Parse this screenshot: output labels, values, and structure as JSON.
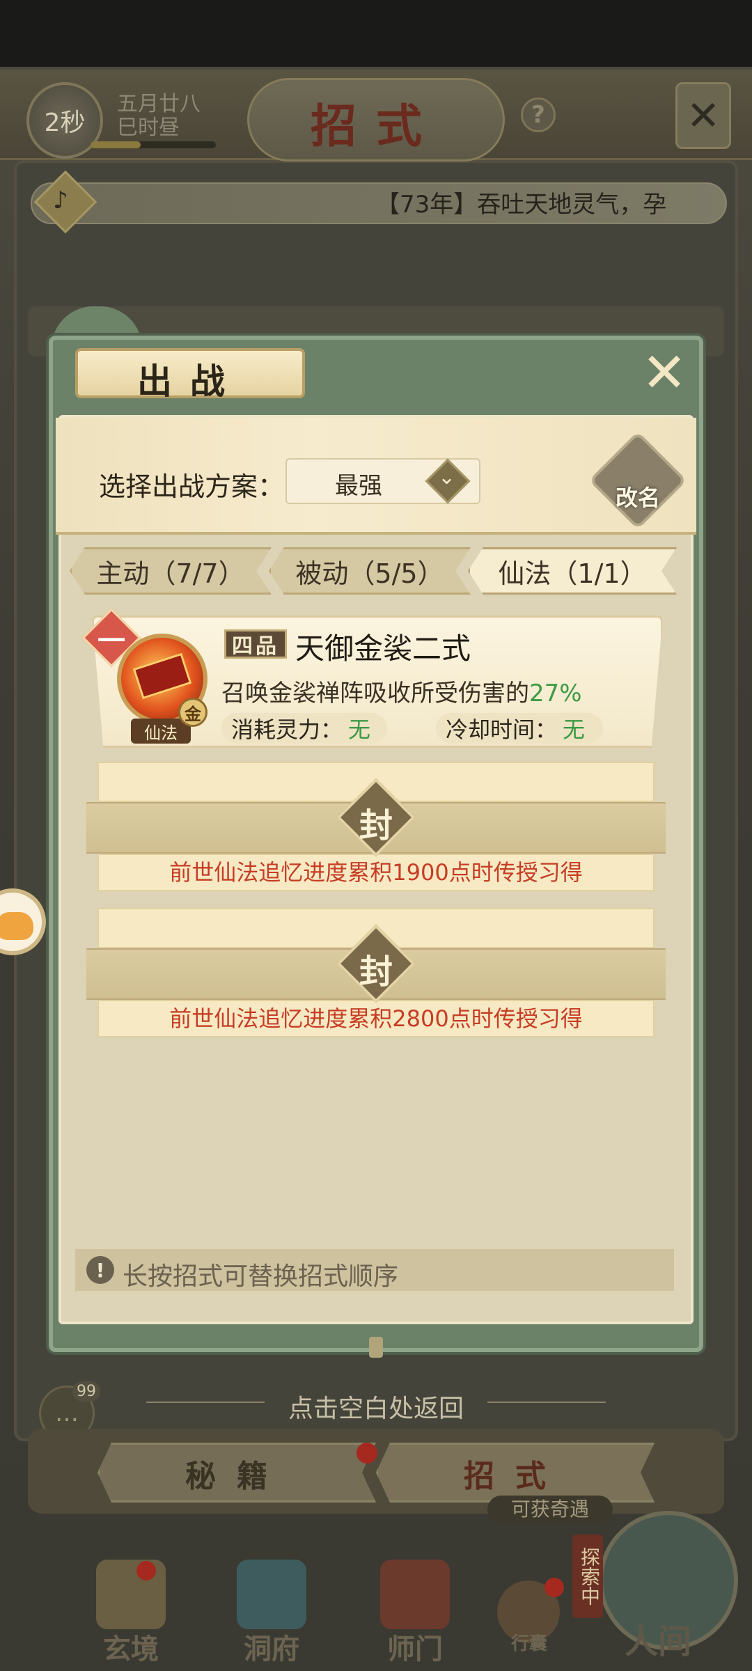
{
  "header": {
    "timer": "2秒",
    "date_line1": "五月廿八",
    "date_line2": "巳时昼",
    "title": "招式",
    "help": "?",
    "close": "✕"
  },
  "announcement": {
    "text": "【73年】吞吐天地灵气，孕",
    "bell_icon": "bell-icon"
  },
  "modal": {
    "title": "出战",
    "close": "✕",
    "scheme": {
      "label": "选择出战方案：",
      "selected": "最强",
      "rename": "改名"
    },
    "tabs": [
      {
        "label": "主动（7/7）",
        "active": false
      },
      {
        "label": "被动（5/5）",
        "active": false
      },
      {
        "label": "仙法（1/1）",
        "active": true
      }
    ],
    "skill": {
      "slot": "一",
      "grade": "四品",
      "name": "天御金裟二式",
      "desc_prefix": "召唤金裟禅阵吸收所受伤害的",
      "desc_pct": "27%",
      "type_tag": "仙法",
      "element_tag": "金",
      "cost_label": "消耗灵力：",
      "cost_value": "无",
      "cooldown_label": "冷却时间：",
      "cooldown_value": "无"
    },
    "sealed_slots": [
      {
        "seal": "封",
        "requirement": "前世仙法追忆进度累积1900点时传授习得"
      },
      {
        "seal": "封",
        "requirement": "前世仙法追忆进度累积2800点时传授习得"
      }
    ],
    "hint": "长按招式可替换招式顺序"
  },
  "footer": {
    "return_hint": "点击空白处返回",
    "chat_badge": "99",
    "tabs": [
      "秘籍",
      "招式"
    ],
    "encounter": "可获奇遇",
    "explore": "探索中",
    "nav": [
      {
        "label": "玄境",
        "icon": "scroll-icon"
      },
      {
        "label": "洞府",
        "icon": "pavilion-icon"
      },
      {
        "label": "师门",
        "icon": "banner-icon"
      },
      {
        "label": "行囊",
        "icon": "bag-icon"
      }
    ],
    "world": "人间"
  },
  "colors": {
    "modal_frame": "#6c8268",
    "parchment": "#ddd3b6",
    "seal_text_red": "#c63d24",
    "value_green": "#3c9a44"
  }
}
